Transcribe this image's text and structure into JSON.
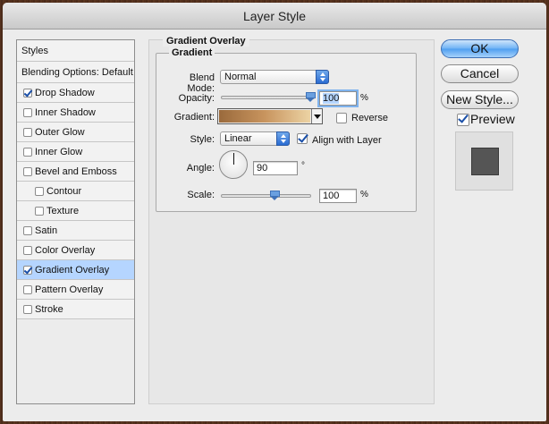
{
  "window": {
    "title": "Layer Style"
  },
  "styles_list": {
    "items": [
      {
        "label": "Styles",
        "checkbox": false,
        "checked": false,
        "selected": false
      },
      {
        "label": "Blending Options: Default",
        "checkbox": false,
        "checked": false,
        "selected": false
      },
      {
        "label": "Drop Shadow",
        "checkbox": true,
        "checked": true,
        "selected": false
      },
      {
        "label": "Inner Shadow",
        "checkbox": true,
        "checked": false,
        "selected": false
      },
      {
        "label": "Outer Glow",
        "checkbox": true,
        "checked": false,
        "selected": false
      },
      {
        "label": "Inner Glow",
        "checkbox": true,
        "checked": false,
        "selected": false
      },
      {
        "label": "Bevel and Emboss",
        "checkbox": true,
        "checked": false,
        "selected": false
      },
      {
        "label": "Contour",
        "checkbox": true,
        "checked": false,
        "selected": false,
        "sub": true
      },
      {
        "label": "Texture",
        "checkbox": true,
        "checked": false,
        "selected": false,
        "sub": true
      },
      {
        "label": "Satin",
        "checkbox": true,
        "checked": false,
        "selected": false
      },
      {
        "label": "Color Overlay",
        "checkbox": true,
        "checked": false,
        "selected": false
      },
      {
        "label": "Gradient Overlay",
        "checkbox": true,
        "checked": true,
        "selected": true
      },
      {
        "label": "Pattern Overlay",
        "checkbox": true,
        "checked": false,
        "selected": false
      },
      {
        "label": "Stroke",
        "checkbox": true,
        "checked": false,
        "selected": false
      }
    ]
  },
  "panel": {
    "section_title": "Gradient Overlay",
    "group_title": "Gradient",
    "blend_mode": {
      "label": "Blend Mode:",
      "value": "Normal"
    },
    "opacity": {
      "label": "Opacity:",
      "value": "100",
      "unit": "%",
      "level": 1.0
    },
    "gradient": {
      "label": "Gradient:",
      "colors": [
        "#9a6a3c",
        "#c8945e",
        "#ecd3a4"
      ]
    },
    "reverse": {
      "label": "Reverse",
      "checked": false
    },
    "style": {
      "label": "Style:",
      "value": "Linear"
    },
    "align_with_layer": {
      "label": "Align with Layer",
      "checked": true
    },
    "angle": {
      "label": "Angle:",
      "value": "90",
      "unit": "°"
    },
    "scale": {
      "label": "Scale:",
      "value": "100",
      "unit": "%",
      "level": 0.6
    }
  },
  "buttons": {
    "ok": "OK",
    "cancel": "Cancel",
    "new_style": "New Style..."
  },
  "preview": {
    "label": "Preview",
    "checked": true
  }
}
